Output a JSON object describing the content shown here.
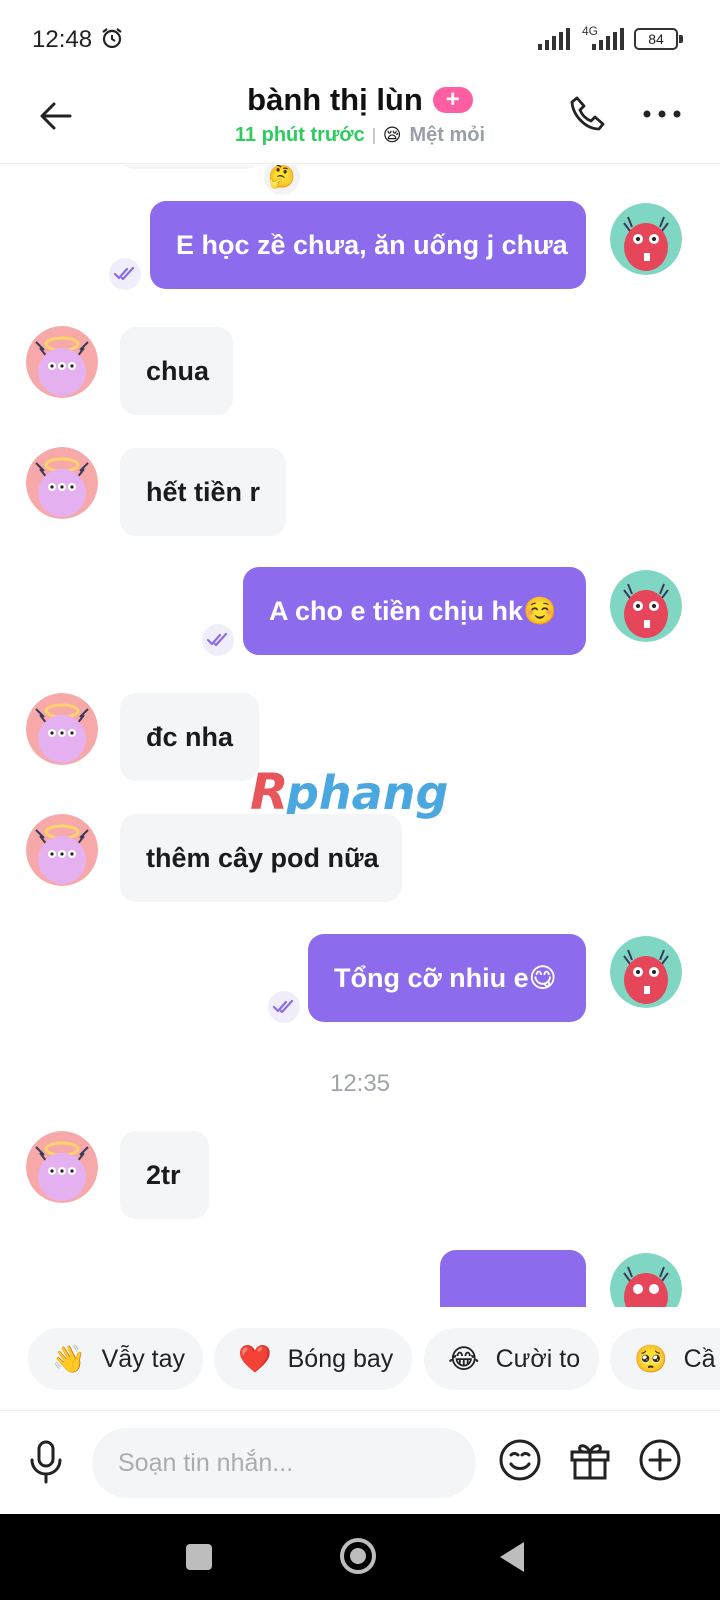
{
  "status_bar": {
    "time": "12:48",
    "network": "4G",
    "battery": "84"
  },
  "header": {
    "contact_name": "bành thị lùn",
    "badge": "+",
    "last_seen": "11 phút trước",
    "mood_icon": "tired-face",
    "mood": "Mệt mỏi"
  },
  "messages": [
    {
      "side": "out",
      "text": "E học zề chưa, ăn uống j chưa"
    },
    {
      "side": "in",
      "text": "chua"
    },
    {
      "side": "in",
      "text": "hết tiền r"
    },
    {
      "side": "out",
      "text": "A cho e tiền chịu hk☺️"
    },
    {
      "side": "in",
      "text": "đc nha"
    },
    {
      "side": "in",
      "text": "thêm cây pod nữa"
    },
    {
      "side": "out",
      "text": "Tổng cỡ nhiu e😋"
    },
    {
      "side": "in",
      "text": "2tr"
    }
  ],
  "time_separator": "12:35",
  "reaction_peek": "🤔",
  "watermark": "Rphang",
  "quick_stickers": [
    {
      "emoji": "👋",
      "label": "Vẫy tay"
    },
    {
      "emoji": "❤️",
      "label": "Bóng bay"
    },
    {
      "emoji": "😂",
      "label": "Cười to"
    },
    {
      "emoji": "🥺",
      "label": "Cầ"
    }
  ],
  "composer": {
    "placeholder": "Soạn tin nhắn..."
  },
  "colors": {
    "accent_purple": "#8c6ced",
    "incoming_bg": "#f4f5f7",
    "online_green": "#2ecc5f",
    "badge_pink": "#ff5fa2"
  }
}
